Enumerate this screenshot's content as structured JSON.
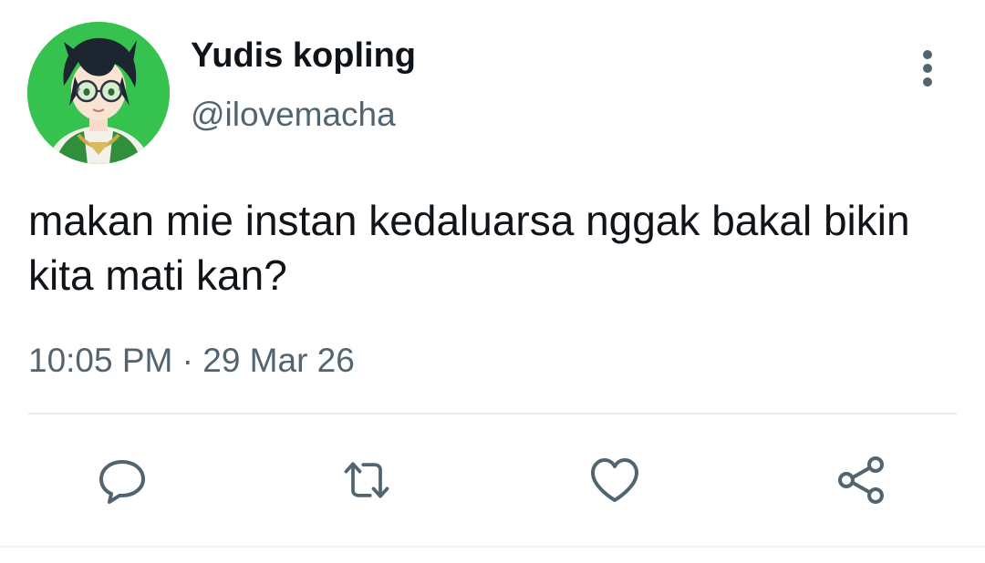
{
  "tweet": {
    "author": {
      "display_name": "Yudis kopling",
      "handle": "@ilovemacha",
      "avatar_icon": "anime-avatar-glasses"
    },
    "text": "makan mie instan kedaluarsa nggak bakal bikin kita mati kan?",
    "timestamp": "10:05 PM · 29 Mar 26",
    "actions": [
      {
        "name": "reply",
        "icon": "chat-bubble-icon"
      },
      {
        "name": "retweet",
        "icon": "retweet-icon"
      },
      {
        "name": "like",
        "icon": "heart-icon"
      },
      {
        "name": "share",
        "icon": "share-nodes-icon"
      }
    ],
    "more_icon": "vertical-dots-icon"
  },
  "colors": {
    "text_primary": "#0f1419",
    "text_secondary": "#536471",
    "icon": "#536471",
    "avatar_bg": "#35c24f",
    "divider": "#e8eaec"
  }
}
